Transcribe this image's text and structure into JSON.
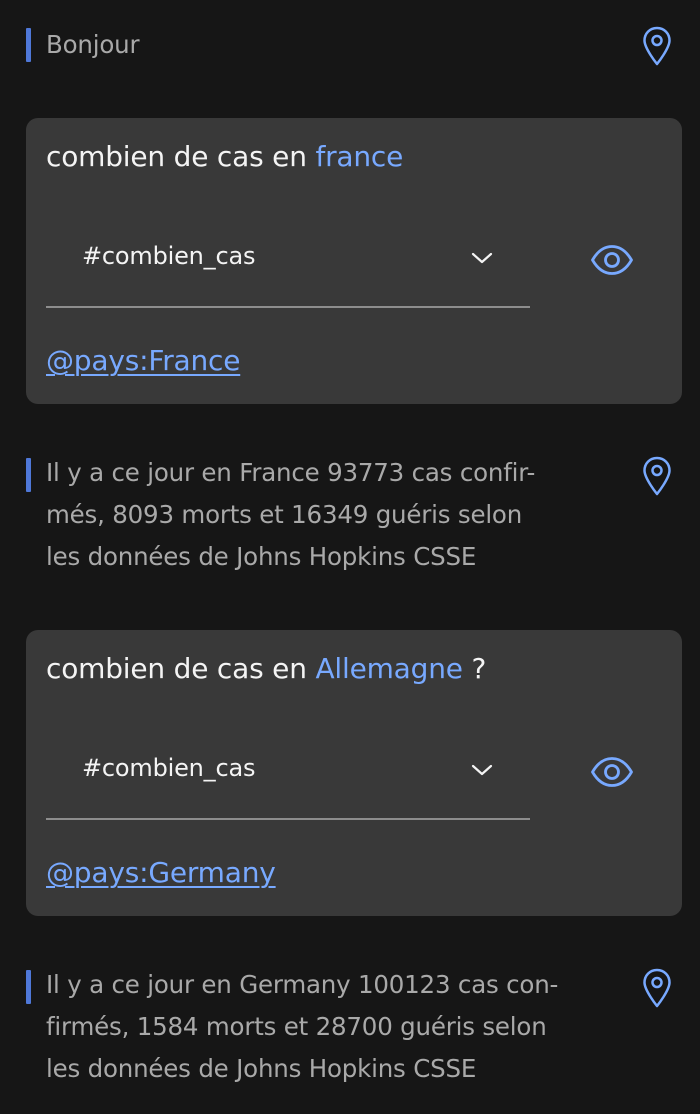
{
  "messages": [
    {
      "type": "bot",
      "text": "Bonjour"
    },
    {
      "type": "user",
      "utterance_prefix": "combien de cas en ",
      "utterance_entity": "france",
      "utterance_suffix": "",
      "intent": "#combien_cas",
      "entity_tag": "@pays:France"
    },
    {
      "type": "bot",
      "text": "Il y a ce jour en France 93773 cas confir-\nmés, 8093 morts et 16349 guéris selon\nles données de Johns Hopkins CSSE"
    },
    {
      "type": "user",
      "utterance_prefix": "combien de cas en ",
      "utterance_entity": "Allemagne",
      "utterance_suffix": " ?",
      "intent": "#combien_cas",
      "entity_tag": "@pays:Germany"
    },
    {
      "type": "bot",
      "text": "Il y a ce jour en Germany 100123 cas con-\nfirmés, 1584 morts et 28700 guéris selon\nles données de Johns Hopkins CSSE"
    }
  ],
  "colors": {
    "background": "#161616",
    "card": "#393939",
    "accent": "#78a9ff",
    "bot_bar": "#4f78d8",
    "bot_text": "#a9a9a9"
  },
  "icons": {
    "location": "location-pin-icon",
    "dropdown": "chevron-down-icon",
    "view": "eye-icon"
  }
}
